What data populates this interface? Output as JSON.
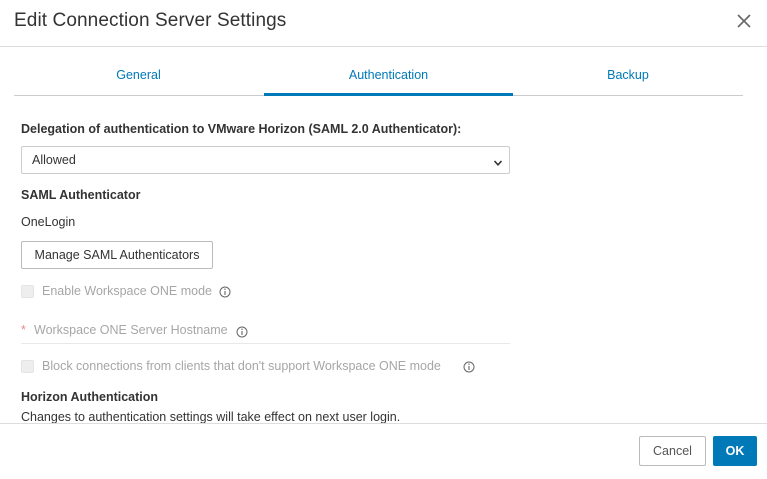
{
  "dialog": {
    "title": "Edit Connection Server Settings",
    "close_icon": "close-icon"
  },
  "tabs": [
    {
      "label": "General",
      "active": false
    },
    {
      "label": "Authentication",
      "active": true
    },
    {
      "label": "Backup",
      "active": false
    }
  ],
  "authentication": {
    "delegation_label": "Delegation of authentication to VMware Horizon (SAML 2.0 Authenticator):",
    "delegation_value": "Allowed",
    "saml_section_title": "SAML Authenticator",
    "saml_authenticator_value": "OneLogin",
    "manage_button_label": "Manage SAML Authenticators",
    "workspace_one_mode_label": "Enable Workspace ONE mode",
    "workspace_one_hostname_label": "Workspace ONE Server Hostname",
    "required_marker": "*",
    "block_connections_label": "Block connections from clients that don't support Workspace ONE mode",
    "horizon_auth_title": "Horizon Authentication",
    "horizon_auth_note": "Changes to authentication settings will take effect on next user login."
  },
  "footer": {
    "cancel_label": "Cancel",
    "ok_label": "OK"
  },
  "colors": {
    "accent": "#0079b8",
    "disabled_text": "#a6a6a6",
    "required": "#e58b8b"
  }
}
